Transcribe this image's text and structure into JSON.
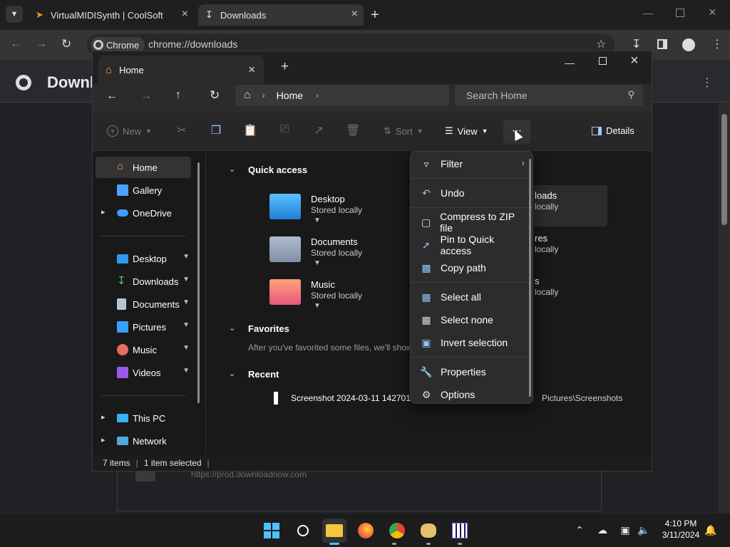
{
  "chrome": {
    "tabs": [
      {
        "label": "VirtualMIDISynth | CoolSoft"
      },
      {
        "label": "Downloads"
      }
    ],
    "omnibox": {
      "chip": "Chrome",
      "url": "chrome://downloads"
    },
    "page_title": "Downl",
    "download_url": "https://prod.downloadnow.com"
  },
  "explorer": {
    "tab_label": "Home",
    "breadcrumb": "Home",
    "search_placeholder": "Search Home",
    "commands": {
      "new": "New",
      "sort": "Sort",
      "view": "View",
      "details": "Details"
    },
    "nav": {
      "home": "Home",
      "gallery": "Gallery",
      "onedrive": "OneDrive",
      "desktop": "Desktop",
      "downloads": "Downloads",
      "documents": "Documents",
      "pictures": "Pictures",
      "music": "Music",
      "videos": "Videos",
      "thispc": "This PC",
      "network": "Network"
    },
    "sections": {
      "quick_access": "Quick access",
      "favorites": "Favorites",
      "favorites_hint": "After you've favorited some files, we'll show",
      "recent": "Recent"
    },
    "quick_items": [
      {
        "name": "Desktop",
        "sub": "Stored locally"
      },
      {
        "name": "Documents",
        "sub": "Stored locally"
      },
      {
        "name": "Music",
        "sub": "Stored locally"
      }
    ],
    "right_items": [
      {
        "name": "loads",
        "sub": "locally"
      },
      {
        "name": "res",
        "sub": "locally"
      },
      {
        "name": "s",
        "sub": "locally"
      }
    ],
    "recent_item": {
      "name": "Screenshot 2024-03-11 142701.",
      "location": "Pictures\\Screenshots"
    },
    "status": {
      "count": "7 items",
      "selected": "1 item selected"
    }
  },
  "menu": {
    "filter": "Filter",
    "undo": "Undo",
    "compress": "Compress to ZIP file",
    "pin": "Pin to Quick access",
    "copy_path": "Copy path",
    "select_all": "Select all",
    "select_none": "Select none",
    "invert": "Invert selection",
    "properties": "Properties",
    "options": "Options"
  },
  "taskbar": {
    "time": "4:10 PM",
    "date": "3/11/2024"
  },
  "colors": {
    "accent": "#0078d4",
    "folder_blue": "#3aa0ff",
    "folder_music": "#e86d5f"
  }
}
